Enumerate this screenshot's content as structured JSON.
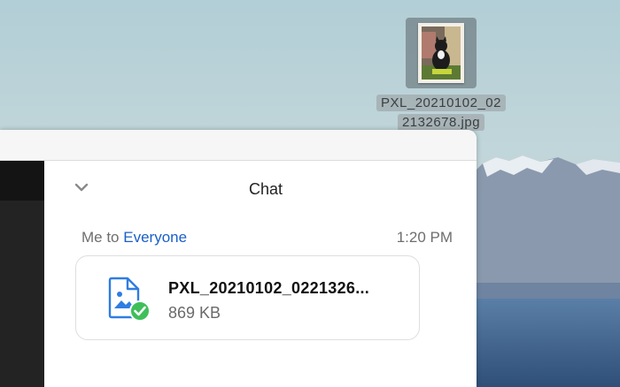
{
  "desktop": {
    "file_label_line1": "PXL_20210102_02",
    "file_label_line2": "2132678.jpg",
    "thumbnail_icon": "cat-photo-thumbnail-icon"
  },
  "chat": {
    "title": "Chat",
    "collapse_icon": "chevron-down-icon",
    "message": {
      "sender": "Me to ",
      "recipient": "Everyone",
      "time": "1:20 PM"
    },
    "attachment": {
      "name": "PXL_20210102_0221326...",
      "size": "869 KB",
      "icon": "image-file-icon",
      "status_icon": "checkmark-icon"
    }
  },
  "colors": {
    "accent": "#1a5fc8",
    "success": "#3fbf5a",
    "file_icon": "#2f7de1"
  }
}
